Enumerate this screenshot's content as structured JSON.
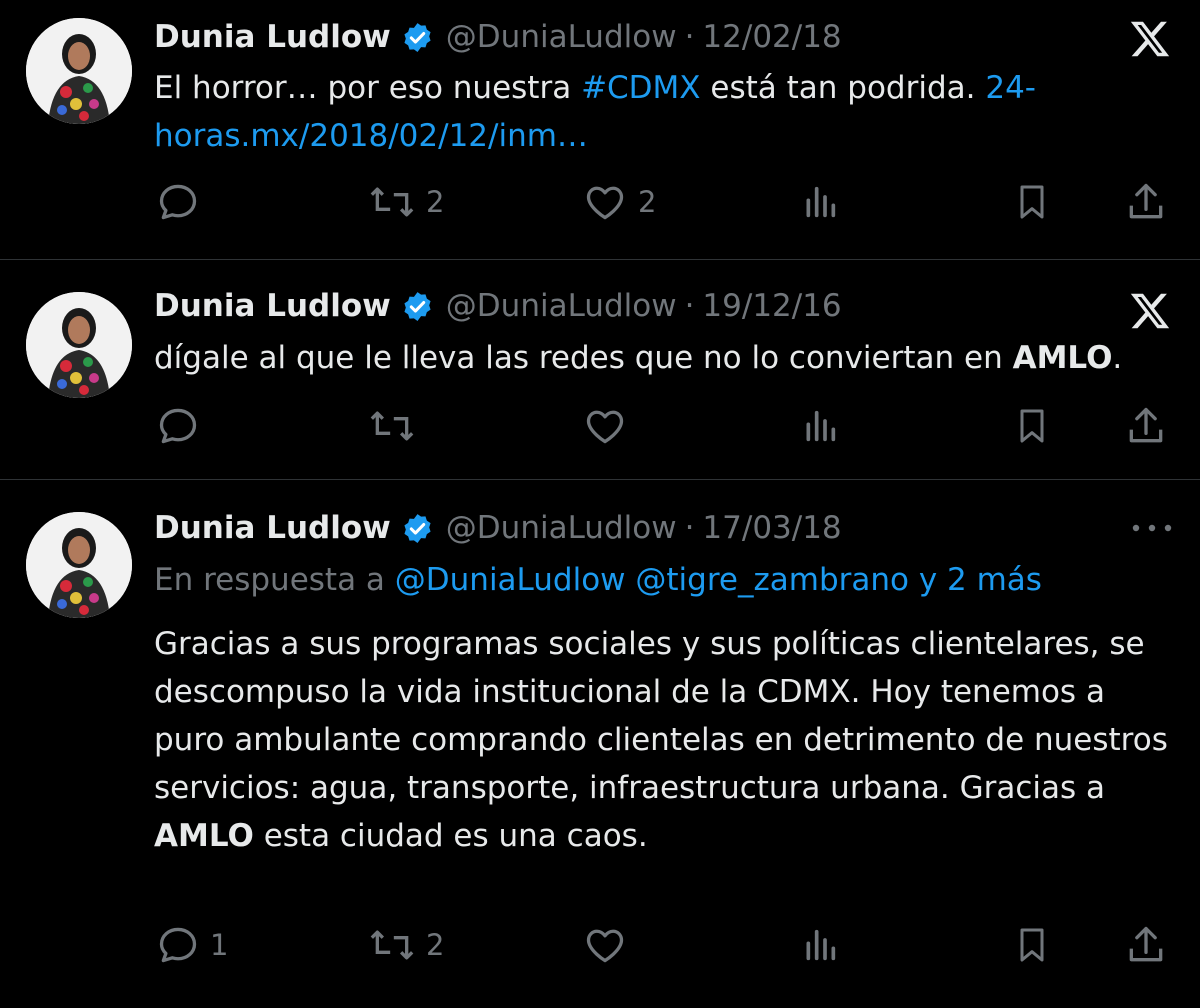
{
  "colors": {
    "background": "#000000",
    "text": "#e7e9ea",
    "muted": "#71767b",
    "link": "#1d9bf0",
    "divider": "#2f3336"
  },
  "tweets": [
    {
      "name": "Dunia Ludlow",
      "handle": "@DuniaLudlow",
      "separator": "·",
      "date": "12/02/18",
      "corner_icon": "x-logo-icon",
      "text_before": "El horror… por eso nuestra ",
      "hashtag": "#CDMX",
      "text_middle": " está tan podrida. ",
      "link": "24-horas.mx/2018/02/12/inm…",
      "counts": {
        "reply": "",
        "retweet": "2",
        "like": "2"
      }
    },
    {
      "name": "Dunia Ludlow",
      "handle": "@DuniaLudlow",
      "separator": "·",
      "date": "19/12/16",
      "corner_icon": "x-logo-icon",
      "text_before": "dígale al que le lleva las redes que no lo conviertan en ",
      "bold": "AMLO",
      "text_after": ".",
      "counts": {
        "reply": "",
        "retweet": "",
        "like": ""
      }
    },
    {
      "name": "Dunia Ludlow",
      "handle": "@DuniaLudlow",
      "separator": "·",
      "date": "17/03/18",
      "corner_icon": "more-icon",
      "reply_prefix": "En respuesta a ",
      "reply_mentions": "@DuniaLudlow @tigre_zambrano y 2 más",
      "text_before": "Gracias a sus programas sociales y sus políticas clientelares, se descompuso la vida institucional de la CDMX. Hoy tenemos a puro ambulante comprando clientelas en detrimento de nuestros servicios: agua, transporte, infraestructura urbana. Gracias a ",
      "bold": "AMLO",
      "text_after": " esta ciudad es una caos.",
      "counts": {
        "reply": "1",
        "retweet": "2",
        "like": ""
      }
    }
  ]
}
